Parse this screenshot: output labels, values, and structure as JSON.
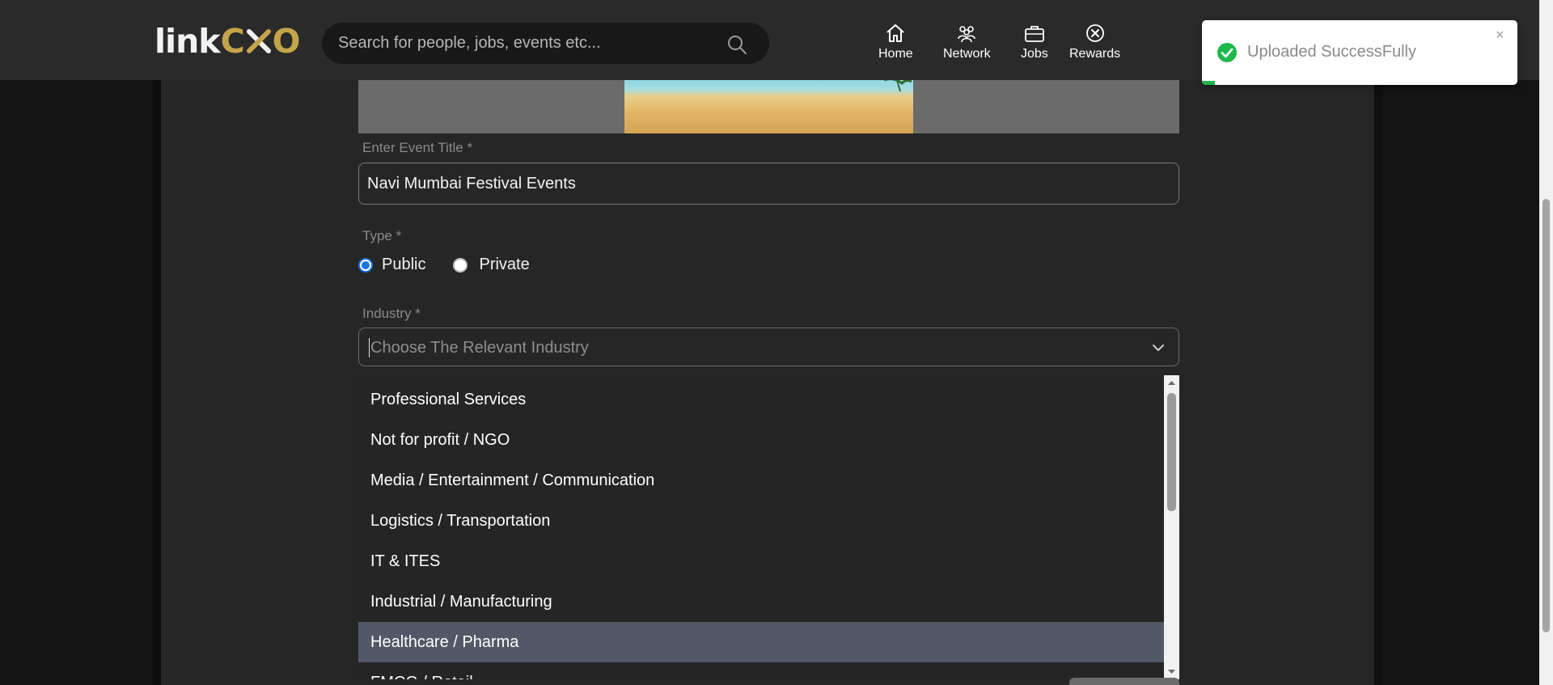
{
  "header": {
    "logo_text": "linkCXO",
    "search_placeholder": "Search for people, jobs, events etc...",
    "nav": [
      {
        "label": "Home",
        "icon": "home-icon"
      },
      {
        "label": "Network",
        "icon": "network-icon"
      },
      {
        "label": "Jobs",
        "icon": "briefcase-icon"
      },
      {
        "label": "Rewards",
        "icon": "rewards-icon"
      }
    ]
  },
  "form": {
    "title_label": "Enter Event Title *",
    "title_value": "Navi Mumbai Festival Events",
    "type_label": "Type *",
    "type_options": [
      {
        "label": "Public",
        "checked": true
      },
      {
        "label": "Private",
        "checked": false
      }
    ],
    "industry_label": "Industry *",
    "industry_placeholder": "Choose The Relevant Industry",
    "industry_options": [
      "Professional Services",
      "Not for profit / NGO",
      "Media / Entertainment / Communication",
      "Logistics / Transportation",
      "IT & ITES",
      "Industrial / Manufacturing",
      "Healthcare / Pharma",
      "FMCG / Retail"
    ],
    "highlighted_option": "Healthcare / Pharma"
  },
  "toast": {
    "message": "Uploaded SuccessFully",
    "close": "×",
    "progress_fraction": 0.01
  },
  "colors": {
    "brand_gold": "#c4a44a",
    "toast_success": "#1fb84a",
    "radio_accent": "#1a73e8",
    "highlight_row": "#525866"
  }
}
